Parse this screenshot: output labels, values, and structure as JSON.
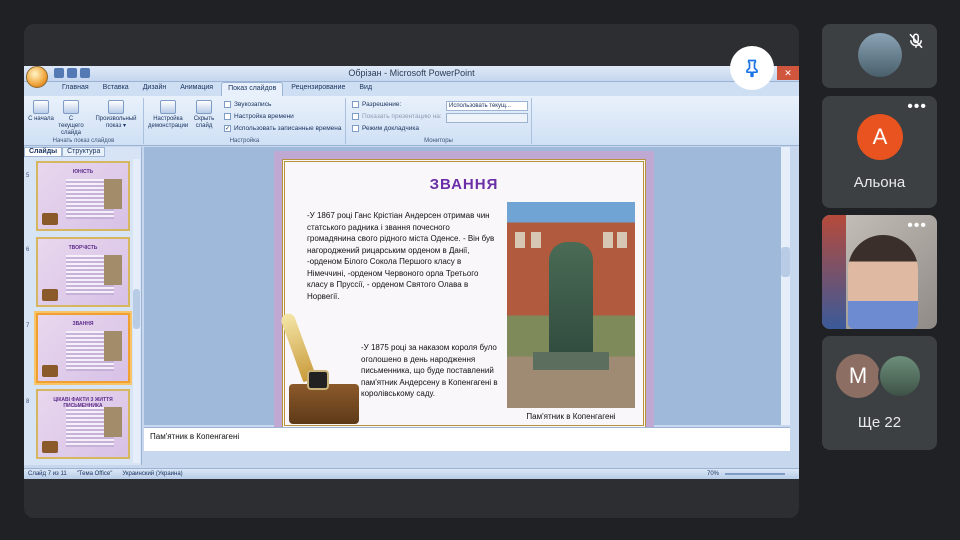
{
  "window": {
    "title": "Обрізан - Microsoft PowerPoint",
    "controls": [
      "–",
      "□",
      "✕"
    ]
  },
  "ribbon": {
    "tabs": [
      "Главная",
      "Вставка",
      "Дизайн",
      "Анимация",
      "Показ слайдов",
      "Рецензирование",
      "Вид"
    ],
    "active_tab": "Показ слайдов",
    "group_start": {
      "label": "Начать показ слайдов",
      "buttons": [
        "С начала",
        "С текущего слайда",
        "Произвольный показ ▾"
      ]
    },
    "group_setup": {
      "label": "Настройка",
      "buttons": [
        "Настройка демонстрации",
        "Скрыть слайд"
      ],
      "items": [
        "Звукозапись",
        "Настройка времени",
        "Использовать записанные времена"
      ]
    },
    "group_monitors": {
      "label": "Мониторы",
      "resolution_label": "Разрешение:",
      "resolution_value": "Использовать текущ...",
      "show_on_label": "Показать презентацию на:",
      "presenter_view": "Режим докладчика"
    }
  },
  "left_pane": {
    "tabs": [
      "Слайды",
      "Структура"
    ],
    "thumbnails": [
      {
        "num": "5",
        "title": "ЮНІСТЬ"
      },
      {
        "num": "6",
        "title": "ТВОРЧІСТЬ"
      },
      {
        "num": "7",
        "title": "ЗВАННЯ"
      },
      {
        "num": "8",
        "title": "ЦІКАВІ ФАКТИ З ЖИТТЯ ПИСЬМЕННИКА"
      }
    ]
  },
  "slide": {
    "title": "ЗВАННЯ",
    "text1": "-У 1867 році Ганс Крістіан Андерсен отримав чин статського радника і звання почесного громадянина свого рідного міста Оденсе. - Він був нагороджений рицарським орденом в Данії, -орденом Білого Сокола Першого класу в Німеччині, -орденом Червоного орла Третього класу в Пруссії, - орденом Святого Олава в Норвегії.",
    "text2": "-У 1875 році за наказом короля було оголошено в день народження письменника, що буде поставлений пам'ятник Андерсену в Копенгагені в королівському саду.",
    "caption": "Пам'ятник в Копенгагені"
  },
  "notes": "Пам'ятник в Копенгагені",
  "status_bar": {
    "slide_info": "Слайд 7 из 11",
    "theme": "\"Тема Office\"",
    "language": "Украинский (Украина)",
    "zoom": "70%"
  },
  "participants": {
    "more_label": "•••",
    "alona": {
      "initial": "A",
      "name": "Альона",
      "color": "#e8531f"
    },
    "others": {
      "initial": "M",
      "label": "Ще 22",
      "color": "#8d6e63"
    }
  },
  "colors": {
    "pin_icon": "#1a73e8",
    "slide_title": "#6a2ea6"
  }
}
